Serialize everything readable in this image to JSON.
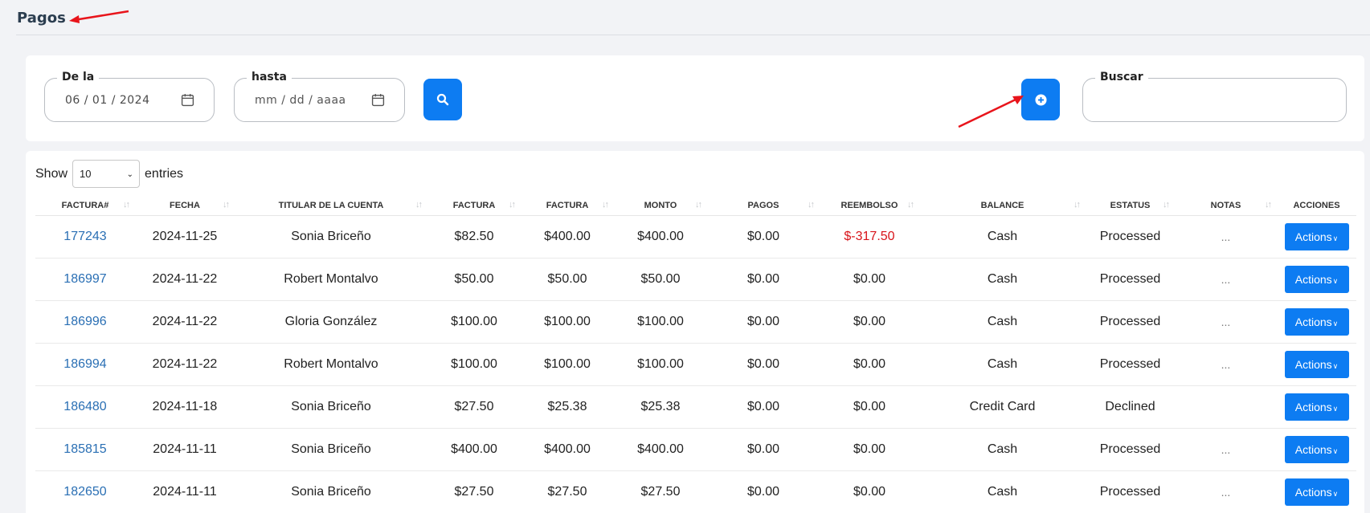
{
  "page": {
    "title": "Pagos"
  },
  "filters": {
    "from_label": "De la",
    "from_value": "06 / 01 / 2024",
    "to_label": "hasta",
    "to_placeholder": "mm / dd / aaaa",
    "search_label": "Buscar",
    "search_value": ""
  },
  "entries": {
    "show_label": "Show",
    "value": "10",
    "entries_label": "entries"
  },
  "table": {
    "columns": [
      "FACTURA#",
      "FECHA",
      "TITULAR DE LA CUENTA",
      "FACTURA",
      "FACTURA",
      "MONTO",
      "PAGOS",
      "REEMBOLSO",
      "BALANCE",
      "ESTATUS",
      "NOTAS",
      "ACCIONES"
    ],
    "rows": [
      {
        "invoice": "177243",
        "date": "2024-11-25",
        "holder": "Sonia Briceño",
        "factura1": "$82.50",
        "factura2": "$400.00",
        "monto": "$400.00",
        "pagos": "$0.00",
        "reembolso": "$-317.50",
        "balance": "Cash",
        "status": "Processed",
        "notes": "...",
        "action": "Actions"
      },
      {
        "invoice": "186997",
        "date": "2024-11-22",
        "holder": "Robert Montalvo",
        "factura1": "$50.00",
        "factura2": "$50.00",
        "monto": "$50.00",
        "pagos": "$0.00",
        "reembolso": "$0.00",
        "balance": "Cash",
        "status": "Processed",
        "notes": "...",
        "action": "Actions"
      },
      {
        "invoice": "186996",
        "date": "2024-11-22",
        "holder": "Gloria González",
        "factura1": "$100.00",
        "factura2": "$100.00",
        "monto": "$100.00",
        "pagos": "$0.00",
        "reembolso": "$0.00",
        "balance": "Cash",
        "status": "Processed",
        "notes": "...",
        "action": "Actions"
      },
      {
        "invoice": "186994",
        "date": "2024-11-22",
        "holder": "Robert Montalvo",
        "factura1": "$100.00",
        "factura2": "$100.00",
        "monto": "$100.00",
        "pagos": "$0.00",
        "reembolso": "$0.00",
        "balance": "Cash",
        "status": "Processed",
        "notes": "...",
        "action": "Actions"
      },
      {
        "invoice": "186480",
        "date": "2024-11-18",
        "holder": "Sonia Briceño",
        "factura1": "$27.50",
        "factura2": "$25.38",
        "monto": "$25.38",
        "pagos": "$0.00",
        "reembolso": "$0.00",
        "balance": "Credit Card",
        "status": "Declined",
        "notes": "",
        "action": "Actions"
      },
      {
        "invoice": "185815",
        "date": "2024-11-11",
        "holder": "Sonia Briceño",
        "factura1": "$400.00",
        "factura2": "$400.00",
        "monto": "$400.00",
        "pagos": "$0.00",
        "reembolso": "$0.00",
        "balance": "Cash",
        "status": "Processed",
        "notes": "...",
        "action": "Actions"
      },
      {
        "invoice": "182650",
        "date": "2024-11-11",
        "holder": "Sonia Briceño",
        "factura1": "$27.50",
        "factura2": "$27.50",
        "monto": "$27.50",
        "pagos": "$0.00",
        "reembolso": "$0.00",
        "balance": "Cash",
        "status": "Processed",
        "notes": "...",
        "action": "Actions"
      }
    ]
  },
  "colors": {
    "primary": "#0d7cf2",
    "link": "#2a6fb4",
    "negative": "#d8141a",
    "arrow": "#e8141b"
  },
  "icons": [
    "calendar-icon",
    "search-icon",
    "add-circle-icon",
    "sort-icon",
    "chevron-down-icon",
    "arrow-annotation"
  ]
}
